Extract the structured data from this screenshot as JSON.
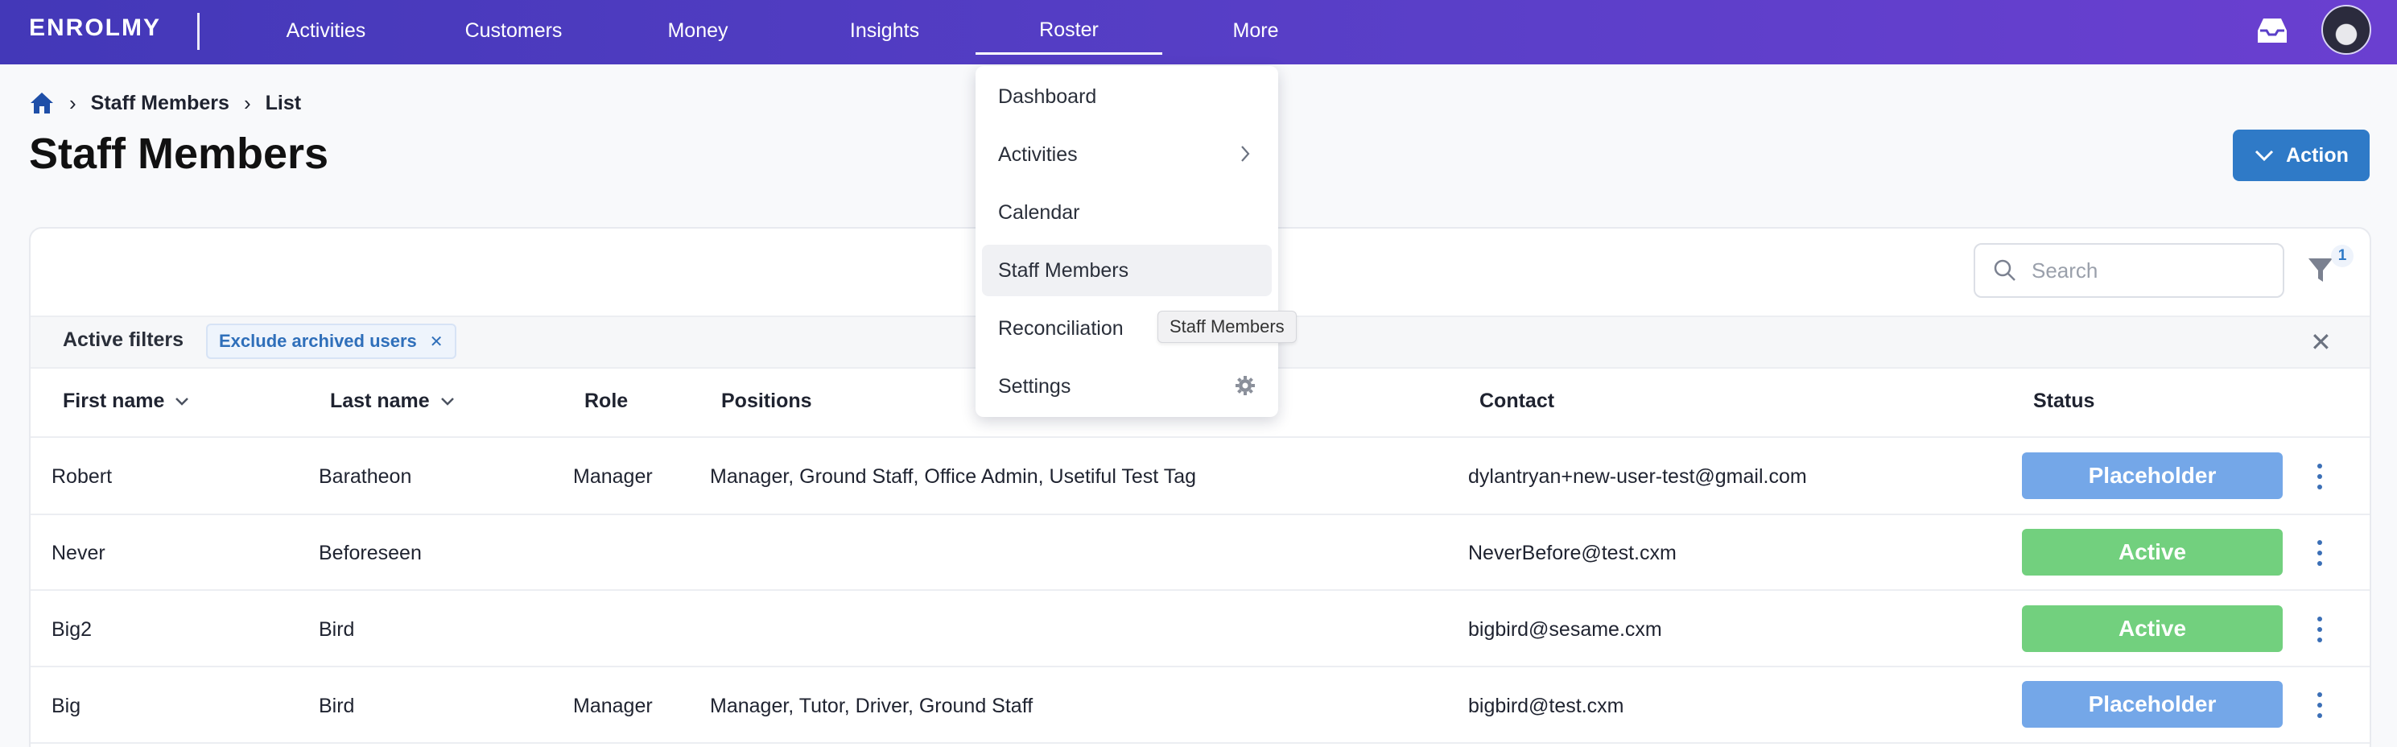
{
  "app": {
    "logo_text": "ENROLMY"
  },
  "nav": {
    "items": [
      {
        "label": "Activities"
      },
      {
        "label": "Customers"
      },
      {
        "label": "Money"
      },
      {
        "label": "Insights"
      },
      {
        "label": "Roster"
      },
      {
        "label": "More"
      }
    ],
    "active": "Roster",
    "icons": {
      "inbox": "inbox-icon",
      "avatar": "user-avatar"
    }
  },
  "breadcrumb": {
    "items": [
      "Staff Members",
      "List"
    ],
    "home_icon": "home-icon"
  },
  "page": {
    "title": "Staff Members",
    "action_label": "Action"
  },
  "toolbar": {
    "search_placeholder": "Search",
    "filter_count": "1"
  },
  "filters": {
    "label": "Active filters",
    "chips": [
      "Exclude archived users"
    ]
  },
  "table": {
    "headers": [
      "First name",
      "Last name",
      "Role",
      "Positions",
      "Contact",
      "Status"
    ],
    "rows": [
      {
        "first": "Robert",
        "last": "Baratheon",
        "role": "Manager",
        "positions": "Manager, Ground Staff, Office Admin, Usetiful Test Tag",
        "contact": "dylantryan+new-user-test@gmail.com",
        "status": "Placeholder"
      },
      {
        "first": "Never",
        "last": "Beforeseen",
        "role": "",
        "positions": "",
        "contact": "NeverBefore@test.cxm",
        "status": "Active"
      },
      {
        "first": "Big2",
        "last": "Bird",
        "role": "",
        "positions": "",
        "contact": "bigbird@sesame.cxm",
        "status": "Active"
      },
      {
        "first": "Big",
        "last": "Bird",
        "role": "Manager",
        "positions": "Manager, Tutor, Driver, Ground Staff",
        "contact": "bigbird@test.cxm",
        "status": "Placeholder"
      }
    ]
  },
  "roster_menu": {
    "items": [
      "Dashboard",
      "Activities",
      "Calendar",
      "Staff Members",
      "Reconciliation",
      "Settings"
    ],
    "selected": "Staff Members",
    "tooltip": "Staff Members"
  },
  "colors": {
    "nav_start": "#4338b8",
    "nav_end": "#6a3fd0",
    "accent": "#2f7ac7",
    "placeholder_status": "#74a7e8",
    "active_status": "#72d07e"
  }
}
